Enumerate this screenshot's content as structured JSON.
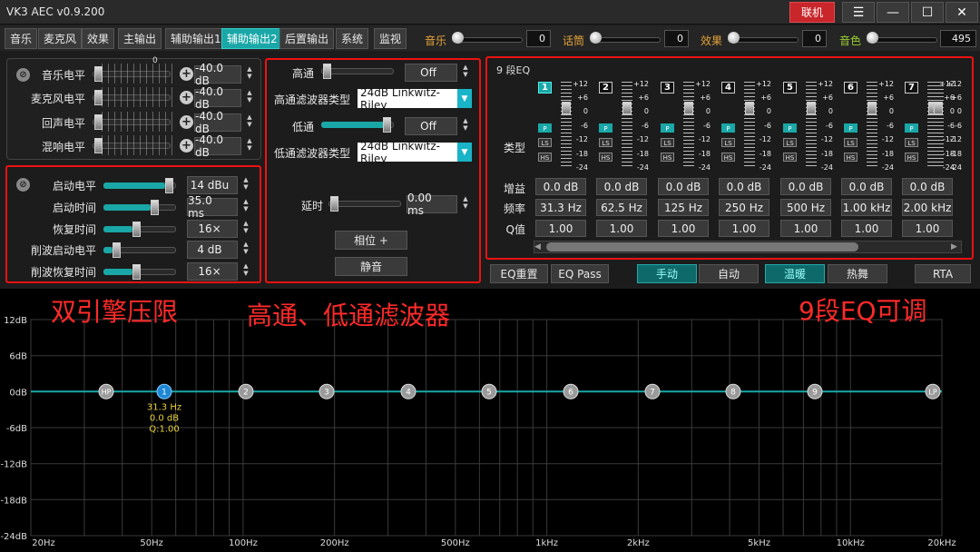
{
  "window": {
    "title": "VK3 AEC v0.9.200",
    "connect": "联机"
  },
  "tabs": [
    "音乐",
    "麦克风",
    "效果",
    "主输出",
    "辅助输出1",
    "辅助输出2",
    "后置输出",
    "系统",
    "监视"
  ],
  "active_tab": 5,
  "globals": [
    {
      "label": "音乐",
      "value": "0"
    },
    {
      "label": "话筒",
      "value": "0"
    },
    {
      "label": "效果",
      "value": "0"
    },
    {
      "label": "音色",
      "value": "495"
    }
  ],
  "levels": {
    "scale_zero": "0",
    "rows": [
      {
        "label": "音乐电平",
        "value": "-40.0 dB"
      },
      {
        "label": "麦克风电平",
        "value": "-40.0 dB"
      },
      {
        "label": "回声电平",
        "value": "-40.0 dB"
      },
      {
        "label": "混响电平",
        "value": "-40.0 dB"
      }
    ]
  },
  "limiter": [
    {
      "label": "启动电平",
      "value": "14 dBu"
    },
    {
      "label": "启动时间",
      "value": "35.0 ms"
    },
    {
      "label": "恢复时间",
      "value": "16×"
    },
    {
      "label": "削波启动电平",
      "value": "4 dB"
    },
    {
      "label": "削波恢复时间",
      "value": "16×"
    }
  ],
  "filters": {
    "hp_label": "高通",
    "hp_value": "Off",
    "hp_type_label": "高通滤波器类型",
    "hp_type": "24dB Linkwitz-Riley",
    "lp_label": "低通",
    "lp_value": "Off",
    "lp_type_label": "低通滤波器类型",
    "lp_type": "24dB Linkwitz-Riley",
    "delay_label": "延时",
    "delay_value": "0.00 ms",
    "phase_btn": "相位 +",
    "mute_btn": "静音"
  },
  "eq": {
    "title": "9 段EQ",
    "type_label": "类型",
    "gain_label": "增益",
    "freq_label": "频率",
    "q_label": "Q值",
    "scale": [
      "+12",
      "+6",
      "0",
      "-6",
      "-12",
      "-18",
      "-24"
    ],
    "bands": [
      {
        "num": "1",
        "gain": "0.0 dB",
        "freq": "31.3 Hz",
        "q": "1.00"
      },
      {
        "num": "2",
        "gain": "0.0 dB",
        "freq": "62.5 Hz",
        "q": "1.00"
      },
      {
        "num": "3",
        "gain": "0.0 dB",
        "freq": "125 Hz",
        "q": "1.00"
      },
      {
        "num": "4",
        "gain": "0.0 dB",
        "freq": "250 Hz",
        "q": "1.00"
      },
      {
        "num": "5",
        "gain": "0.0 dB",
        "freq": "500 Hz",
        "q": "1.00"
      },
      {
        "num": "6",
        "gain": "0.0 dB",
        "freq": "1.00 kHz",
        "q": "1.00"
      },
      {
        "num": "7",
        "gain": "0.0 dB",
        "freq": "2.00 kHz",
        "q": "1.00"
      }
    ],
    "filter_types": [
      "P",
      "LS",
      "HS"
    ]
  },
  "buttons": {
    "eq_reset": "EQ重置",
    "eq_pass": "EQ Pass",
    "manual": "手动",
    "auto": "自动",
    "mild": "温暖",
    "hot": "热舞",
    "rta": "RTA"
  },
  "annotations": {
    "a1": "双引擎压限",
    "a2": "高通、低通滤波器",
    "a3": "9段EQ可调"
  },
  "graph": {
    "y_ticks": [
      "12dB",
      "6dB",
      "0dB",
      "-6dB",
      "-12dB",
      "-18dB",
      "-24dB"
    ],
    "x_ticks": [
      "20Hz",
      "50Hz",
      "100Hz",
      "200Hz",
      "500Hz",
      "1kHz",
      "2kHz",
      "5kHz",
      "10kHz",
      "20kHz"
    ],
    "nodes": [
      "HP",
      "1",
      "2",
      "3",
      "4",
      "5",
      "6",
      "7",
      "8",
      "9",
      "LP"
    ],
    "selected": {
      "freq": "31.3 Hz",
      "gain": "0.0 dB",
      "q": "Q:1.00"
    }
  },
  "colors": {
    "accent": "#1aa7a7",
    "annotation": "#ff2a2a",
    "connect": "#c8262b"
  }
}
